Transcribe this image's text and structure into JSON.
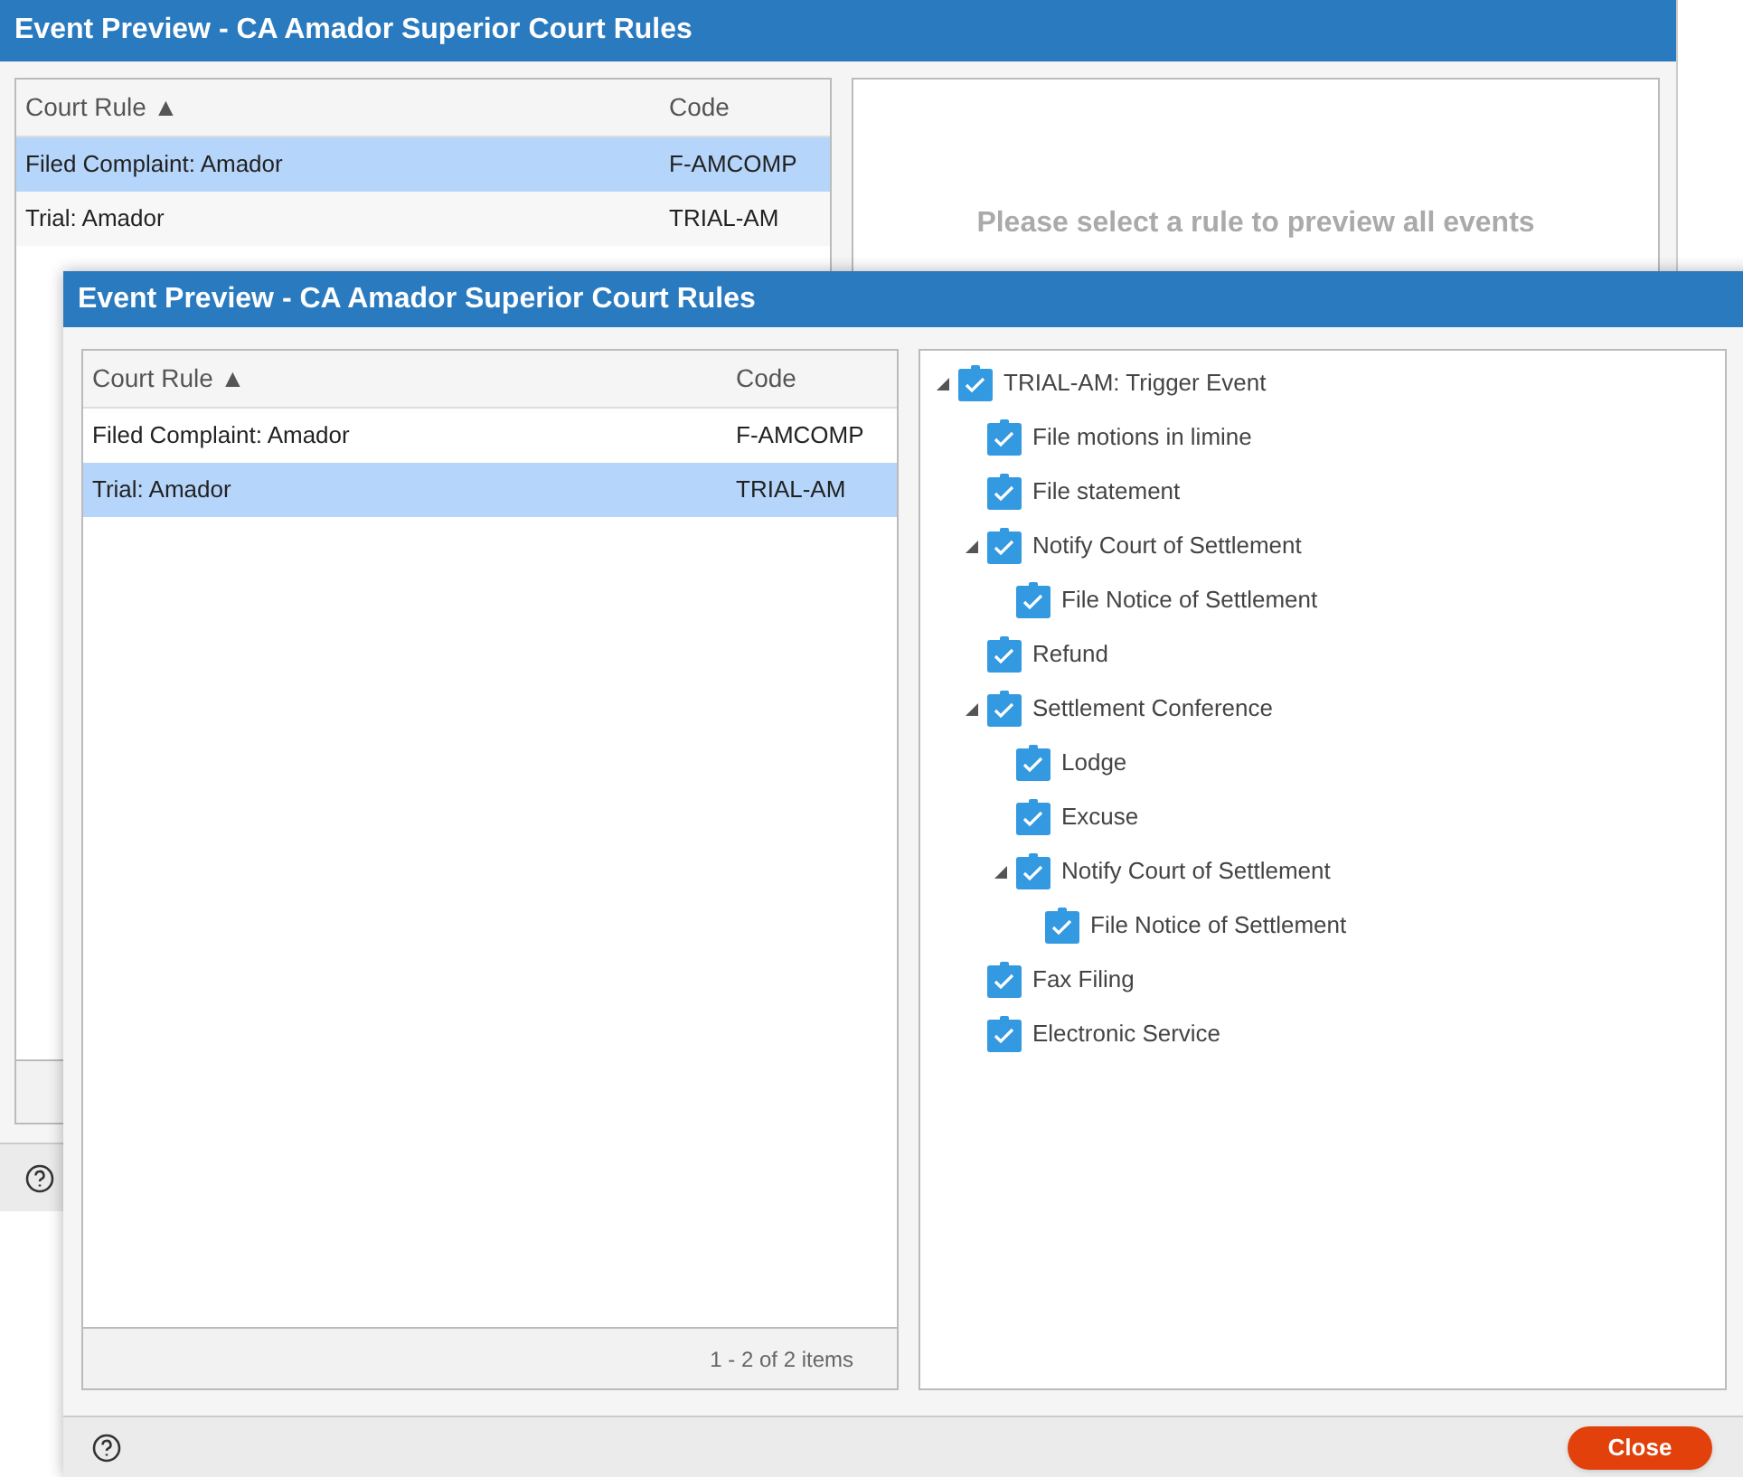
{
  "background_window": {
    "title": "Event Preview - CA Amador Superior Court Rules",
    "grid": {
      "columns": [
        "Court Rule ▲",
        "Code"
      ],
      "rows": [
        {
          "court_rule": "Filed Complaint: Amador",
          "code": "F-AMCOMP",
          "selected": true
        },
        {
          "court_rule": "Trial: Amador",
          "code": "TRIAL-AM",
          "selected": false
        }
      ]
    },
    "preview_message": "Please select a rule to preview all events"
  },
  "dialog": {
    "title": "Event Preview - CA Amador Superior Court Rules",
    "grid": {
      "columns": [
        "Court Rule ▲",
        "Code"
      ],
      "rows": [
        {
          "court_rule": "Filed Complaint: Amador",
          "code": "F-AMCOMP",
          "selected": false
        },
        {
          "court_rule": "Trial: Amador",
          "code": "TRIAL-AM",
          "selected": true
        }
      ],
      "pager": "1 - 2 of 2 items"
    },
    "tree": [
      {
        "label": "TRIAL-AM: Trigger Event",
        "checked": true,
        "expanded": true,
        "children": [
          {
            "label": "File motions in limine",
            "checked": true
          },
          {
            "label": "File statement",
            "checked": true
          },
          {
            "label": "Notify Court of Settlement",
            "checked": true,
            "expanded": true,
            "children": [
              {
                "label": "File Notice of Settlement",
                "checked": true
              }
            ]
          },
          {
            "label": "Refund",
            "checked": true
          },
          {
            "label": "Settlement Conference",
            "checked": true,
            "expanded": true,
            "children": [
              {
                "label": "Lodge",
                "checked": true
              },
              {
                "label": "Excuse",
                "checked": true
              },
              {
                "label": "Notify Court of Settlement",
                "checked": true,
                "expanded": true,
                "children": [
                  {
                    "label": "File Notice of Settlement",
                    "checked": true
                  }
                ]
              }
            ]
          },
          {
            "label": "Fax Filing",
            "checked": true
          },
          {
            "label": "Electronic Service",
            "checked": true
          }
        ]
      }
    ],
    "close_button": "Close"
  }
}
